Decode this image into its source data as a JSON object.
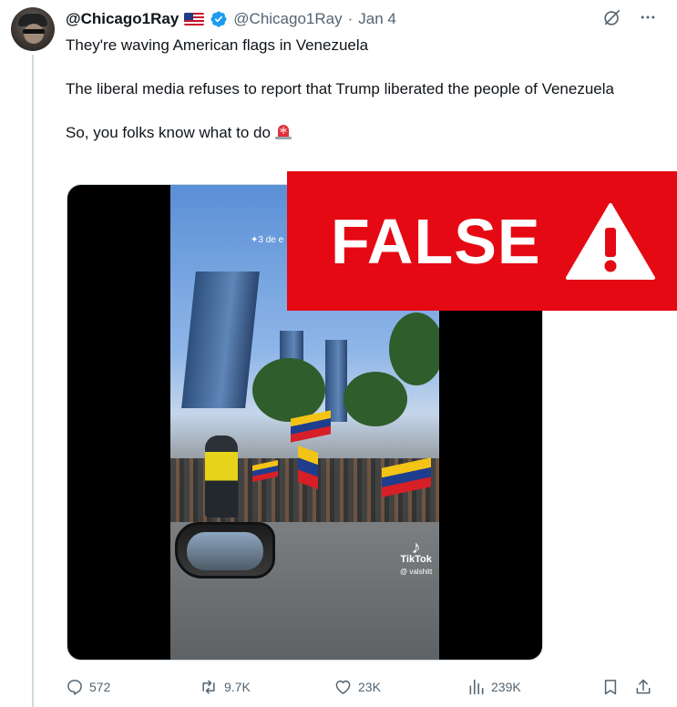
{
  "author": {
    "display_name": "@Chicago1Ray",
    "flag": "us-flag-emoji",
    "verified": true,
    "handle": "@Chicago1Ray",
    "separator": "·",
    "date": "Jan 4",
    "avatar": "avatar"
  },
  "header_actions": {
    "grok_icon": "grok-icon",
    "more_icon": "more-icon"
  },
  "tweet": {
    "line1": "They're waving American flags in Venezuela",
    "line2": "The liberal media refuses to report that Trump liberated the people of Venezuela",
    "line3": "So, you folks know what to do",
    "emoji": "siren-emoji"
  },
  "media": {
    "overlay_date": "✦3 de e",
    "tiktok_brand": "TikTok",
    "tiktok_user": "@ valshitt"
  },
  "verdict": {
    "label": "FALSE",
    "color": "#e50914",
    "icon": "warning-icon"
  },
  "actions": {
    "replies": "572",
    "reposts": "9.7K",
    "likes": "23K",
    "views": "239K"
  },
  "colors": {
    "text": "#0f1419",
    "muted": "#536471",
    "verified_blue": "#1d9bf0"
  }
}
